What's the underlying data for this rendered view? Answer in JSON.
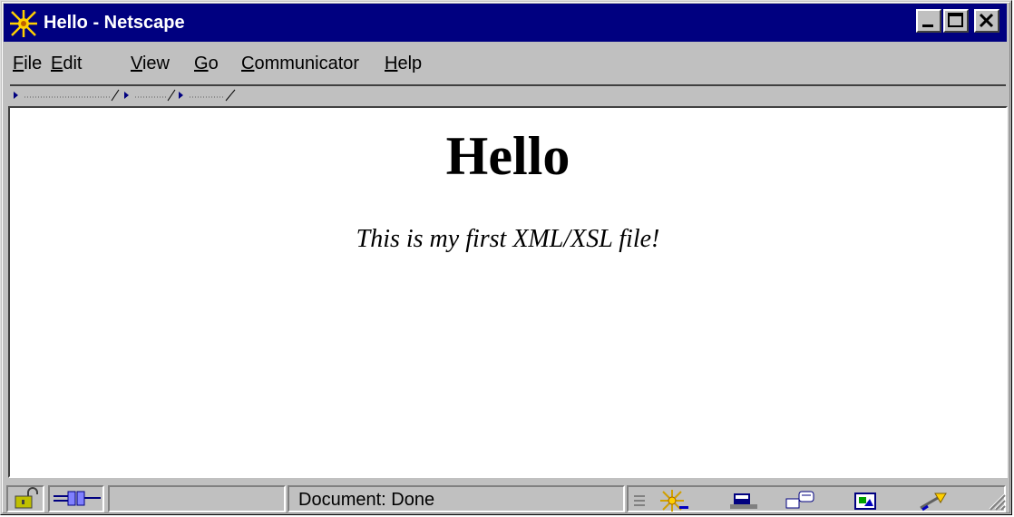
{
  "window": {
    "title": "Hello - Netscape"
  },
  "menu": [
    {
      "label": "File",
      "key": "F",
      "rest": "ile"
    },
    {
      "label": "Edit",
      "key": "E",
      "rest": "dit"
    },
    {
      "label": "View",
      "key": "V",
      "rest": "iew"
    },
    {
      "label": "Go",
      "key": "G",
      "rest": "o"
    },
    {
      "label": "Communicator",
      "key": "C",
      "rest": "ommunicator"
    },
    {
      "label": "Help",
      "key": "H",
      "rest": "elp"
    }
  ],
  "page": {
    "heading": "Hello",
    "paragraph": "This is my first XML/XSL file!"
  },
  "statusbar": {
    "status": "Document: Done"
  },
  "icons": {
    "app": "netscape-logo-icon",
    "security": "unlocked-padlock-icon",
    "connection": "online-connector-icon",
    "component_bar": [
      "navigator-icon",
      "mailbox-icon",
      "discussions-icon",
      "composer-icon",
      "calendar-icon"
    ]
  },
  "colors": {
    "titlebar": "#000080",
    "chrome": "#c0c0c0",
    "title_text": "#ffffff",
    "page_bg": "#ffffff"
  }
}
